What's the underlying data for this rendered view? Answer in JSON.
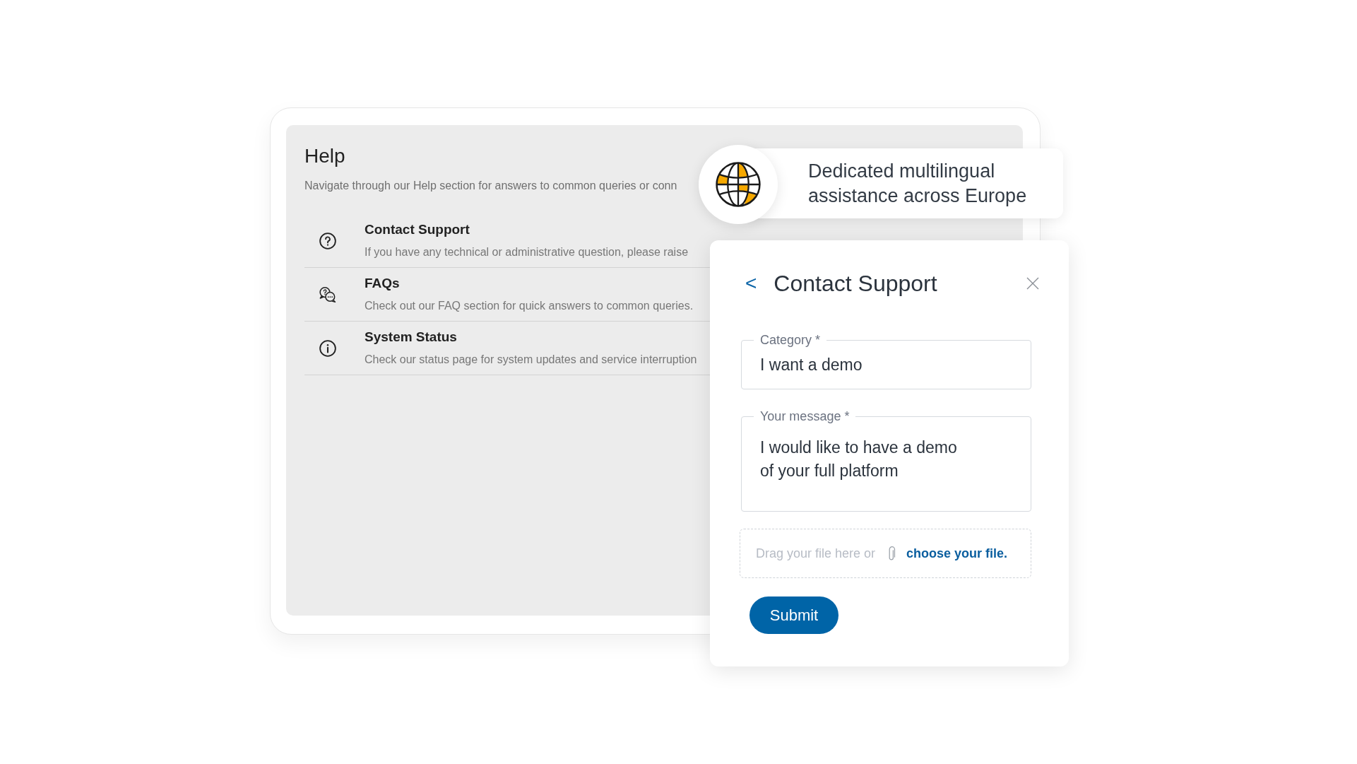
{
  "help": {
    "title": "Help",
    "subtitle": "Navigate through our Help section for answers to common queries or conn",
    "items": [
      {
        "kind": "support",
        "title": "Contact Support",
        "description": "If you have any technical or administrative question, please raise"
      },
      {
        "kind": "faq",
        "title": "FAQs",
        "description": "Check out our FAQ section for quick answers to common queries."
      },
      {
        "kind": "status",
        "title": "System Status",
        "description": "Check our status page for system updates and service interruption"
      }
    ]
  },
  "callout": {
    "text": "Dedicated multilingual assistance across Europe"
  },
  "contact_form": {
    "back": "<",
    "title": "Contact Support",
    "fields": [
      {
        "kind": "input",
        "label": "Category *",
        "value": "I want a demo"
      },
      {
        "kind": "textarea",
        "label": "Your message *",
        "value": "I would like to have a demo of your full platform"
      }
    ],
    "upload": {
      "text": "Drag your file here or",
      "link": "choose your file."
    },
    "submit": "Submit"
  }
}
